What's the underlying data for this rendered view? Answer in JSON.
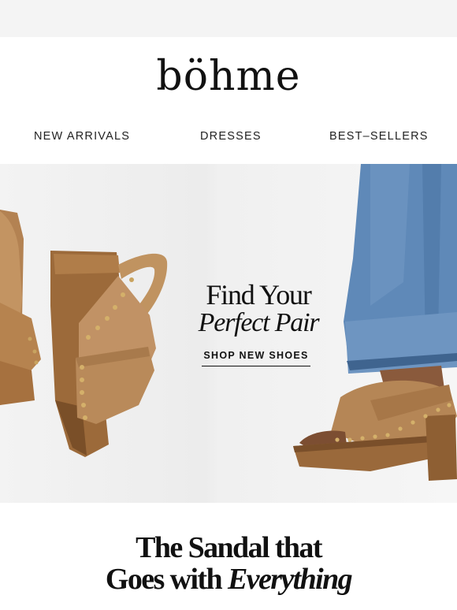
{
  "brand": {
    "logo_text": "böhme"
  },
  "nav": {
    "items": [
      {
        "label": "NEW ARRIVALS"
      },
      {
        "label": "DRESSES"
      },
      {
        "label": "BEST–SELLERS"
      }
    ]
  },
  "hero": {
    "title_line1": "Find Your",
    "title_line2": "Perfect Pair",
    "cta_label": "SHOP NEW SHOES",
    "image_left": "studded-suede-clog-sandal-pair",
    "image_right": "model-wearing-clog-sandal-with-jeans"
  },
  "section": {
    "title_line1": "The Sandal that",
    "title_line2_plain": "Goes with ",
    "title_line2_italic": "Everything"
  },
  "colors": {
    "suede": "#b98a58",
    "wood": "#9a6a3e",
    "denim": "#5c86b5",
    "text": "#111111",
    "page_bg": "#f4f4f4"
  }
}
